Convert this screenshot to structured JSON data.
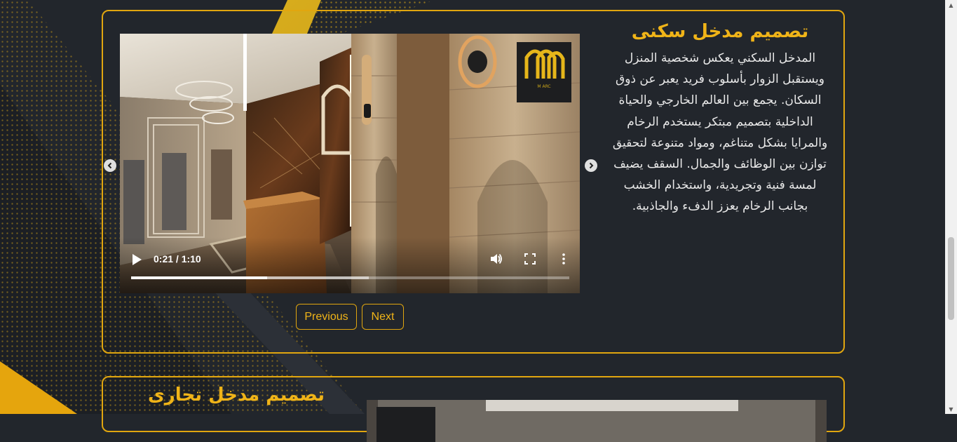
{
  "section1": {
    "title": "تصميم مدخل سكنى",
    "description": "المدخل السكني يعكس شخصية المنزل ويستقبل الزوار بأسلوب فريد يعبر عن ذوق السكان. يجمع بين العالم الخارجي والحياة الداخلية بتصميم مبتكر يستخدم الرخام والمرايا بشكل متناغم، ومواد متنوعة لتحقيق توازن بين الوظائف والجمال. السقف يضيف لمسة فنية وتجريدية، واستخدام الخشب بجانب الرخام يعزز الدفء والجاذبية.",
    "video": {
      "time_display": "0:21 / 1:10",
      "progress_fraction": 0.31,
      "buffered_fraction": 0.543,
      "logo_text": "M ARC"
    },
    "buttons": {
      "previous": "Previous",
      "next": "Next"
    },
    "icons": {
      "prev_arrow": "chevron-left-icon",
      "next_arrow": "chevron-right-icon",
      "play": "play-icon",
      "volume": "volume-icon",
      "fullscreen": "fullscreen-icon",
      "more": "more-options-icon"
    }
  },
  "section2": {
    "title": "تصميم مدخل تجارى"
  },
  "colors": {
    "accent": "#e1a60f",
    "title": "#f0b418",
    "background": "#22262c",
    "text": "#e9e9e9"
  }
}
